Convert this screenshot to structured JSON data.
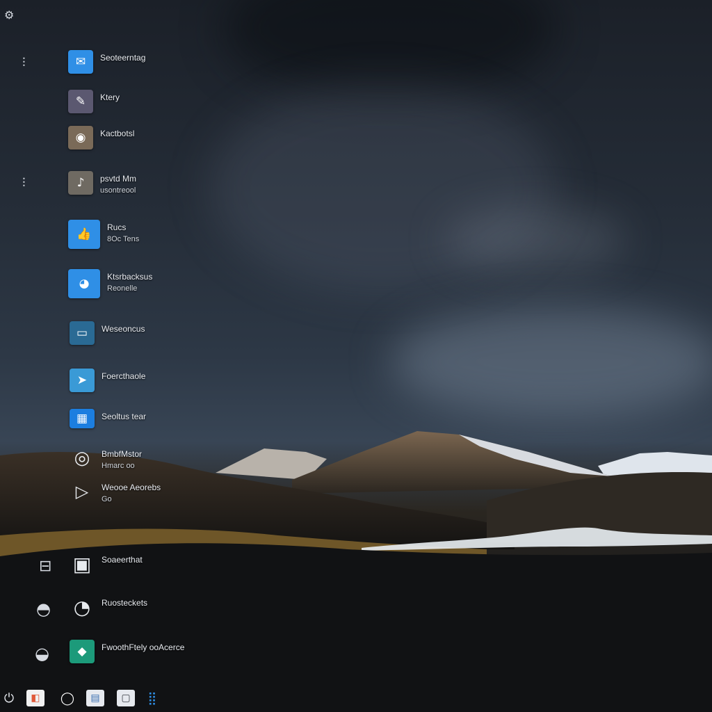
{
  "wallpaper": {
    "sky_color": "#2d3846",
    "mountain_color": "#6b5440",
    "snow_color": "#e8ecf0",
    "grass_color": "#8a6a2a",
    "ground_color": "#0e0f11"
  },
  "top_left": {
    "icon": "settings-icon",
    "glyph": "⚙"
  },
  "dock": [
    {
      "icon": "pin-icon",
      "glyph": "⫶"
    },
    {
      "icon": "handle-icon",
      "glyph": "⫶"
    },
    {
      "icon": "printer-icon",
      "glyph": "⊟"
    },
    {
      "icon": "user-icon",
      "glyph": "◓"
    },
    {
      "icon": "lock-icon",
      "glyph": "◒"
    }
  ],
  "desktop_icons": [
    {
      "icon": "messenger-icon",
      "glyph": "✉",
      "color": "#2f8fe6",
      "label": "Seoteerntag",
      "sub": ""
    },
    {
      "icon": "editor-icon",
      "glyph": "✎",
      "color": "#5b5870",
      "label": "Ktery",
      "sub": ""
    },
    {
      "icon": "camera-icon",
      "glyph": "◉",
      "color": "#7a6a58",
      "label": "Kactbotsl",
      "sub": ""
    },
    {
      "icon": "media-player-icon",
      "glyph": "♪",
      "color": "#6f6a62",
      "label": "psvtd Mm",
      "sub": "usontreool"
    },
    {
      "icon": "thumbs-up-icon",
      "glyph": "👍",
      "color": "#2f8fe6",
      "label": "Rucs",
      "sub": "8Oc Tens"
    },
    {
      "icon": "chat-app-icon",
      "glyph": "◕",
      "color": "#2f8fe6",
      "label": "Ktsrbacksus",
      "sub": "Reonelle"
    },
    {
      "icon": "terminal-icon",
      "glyph": "▭",
      "color": "#2a6a94",
      "label": "Weseoncus",
      "sub": ""
    },
    {
      "icon": "send-icon",
      "glyph": "➤",
      "color": "#3a9ad6",
      "label": "Foercthaole",
      "sub": ""
    },
    {
      "icon": "news-icon",
      "glyph": "▦",
      "color": "#1c7ee0",
      "label": "Seoltus tear",
      "sub": ""
    },
    {
      "icon": "eye-icon",
      "glyph": "◎",
      "color": "transparent",
      "label": "BmbfMstor",
      "sub": "Hmarc oo"
    },
    {
      "icon": "play-icon",
      "glyph": "▷",
      "color": "transparent",
      "label": "Weooe Aeorebs",
      "sub": "Go"
    },
    {
      "icon": "laptop-icon",
      "glyph": "▣",
      "color": "transparent",
      "label": "Soaeerthat",
      "sub": ""
    },
    {
      "icon": "contacts-icon",
      "glyph": "◔",
      "color": "transparent",
      "label": "Ruosteckets",
      "sub": ""
    },
    {
      "icon": "photos-icon",
      "glyph": "◆",
      "color": "#1c9a7a",
      "label": "FwoothFtely ooAcerce",
      "sub": ""
    }
  ],
  "taskbar": [
    {
      "icon": "power-icon",
      "glyph": "⏻",
      "color": "transparent"
    },
    {
      "icon": "browser-icon",
      "glyph": "◧",
      "color": "#e05a3a"
    },
    {
      "icon": "search-icon",
      "glyph": "◯",
      "color": "#ffffff"
    },
    {
      "icon": "store-icon",
      "glyph": "▤",
      "color": "#8ab4e8"
    },
    {
      "icon": "folder-icon",
      "glyph": "▢",
      "color": "#e6e9ee"
    },
    {
      "icon": "app-grid-icon",
      "glyph": "⣿",
      "color": "#2f8fe6"
    }
  ]
}
